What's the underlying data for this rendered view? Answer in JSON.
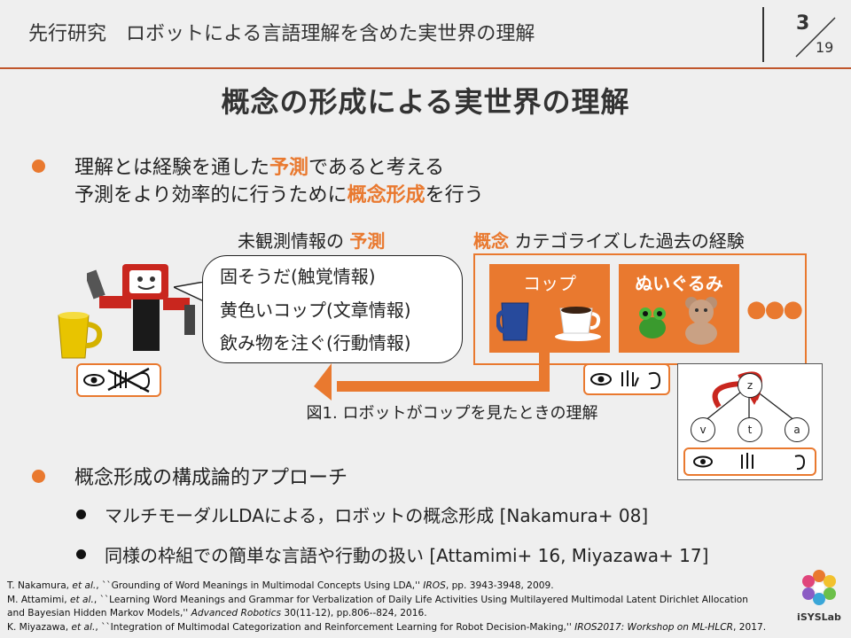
{
  "header": {
    "title": "先行研究　ロボットによる言語理解を含めた実世界の理解",
    "page_current": "3",
    "page_total": "19"
  },
  "slide": {
    "title": "概念の形成による実世界の理解",
    "bullet1": {
      "line1_pre": "理解とは経験を通した",
      "line1_hl": "予測",
      "line1_post": "であると考える",
      "line2_pre": "予測をより効率的に行うために",
      "line2_hl": "概念形成",
      "line2_post": "を行う"
    },
    "figure": {
      "prediction_label_pre": "未観測情報の ",
      "prediction_label_hl": "予測",
      "concept_label_hl": "概念",
      "concept_label_post": " カテゴライズした過去の経験",
      "bubble_lines": [
        "固そうだ(触覚情報)",
        "黄色いコップ(文章情報)",
        "飲み物を注ぐ(行動情報)"
      ],
      "categories": [
        "コップ",
        "ぬいぐるみ"
      ],
      "ellipsis": "●●●",
      "caption": "図1. ロボットがコップを見たときの理解",
      "graph_nodes": {
        "top": "z",
        "left": "v",
        "mid": "t",
        "right": "a"
      }
    },
    "bullet2": "概念形成の構成論的アプローチ",
    "sub_bullets": [
      "マルチモーダルLDAによる，ロボットの概念形成 [Nakamura+ 08]",
      "同様の枠組での簡単な言語や行動の扱い [Attamimi+ 16, Miyazawa+ 17]"
    ]
  },
  "references": {
    "ref1_a": "T. Nakamura, ",
    "ref1_b": "et al.",
    "ref1_c": ", ``Grounding of Word Meanings in Multimodal Concepts Using LDA,'' ",
    "ref1_d": "IROS",
    "ref1_e": ", pp. 3943-3948, 2009.",
    "ref2_a": "M. Attamimi, ",
    "ref2_b": "et al.",
    "ref2_c": ", ``Learning Word Meanings and Grammar for Verbalization of Daily Life Activities Using Multilayered Multimodal Latent Dirichlet Allocation",
    "ref2_d": "and Bayesian Hidden Markov Models,'' ",
    "ref2_e": "Advanced Robotics",
    "ref2_f": " 30(11-12), pp.806--824, 2016.",
    "ref3_a": "K. Miyazawa, ",
    "ref3_b": "et al.",
    "ref3_c": ", ``Integration of Multimodal Categorization and Reinforcement Learning for Robot Decision-Making,'' ",
    "ref3_d": "IROS2017: Workshop on ML-HLCR",
    "ref3_e": ", 2017."
  },
  "logo": {
    "text": "iSYSLab"
  },
  "colors": {
    "accent": "#e9792f",
    "rule": "#c0562b"
  },
  "icons": [
    "eye-icon",
    "hand-icon",
    "ear-icon",
    "crossed-out-hand-ear-icon",
    "robot-icon",
    "yellow-cup-icon",
    "blue-mug-icon",
    "coffee-cup-icon",
    "frog-plush-icon",
    "teddy-bear-icon",
    "arrow-icon"
  ]
}
